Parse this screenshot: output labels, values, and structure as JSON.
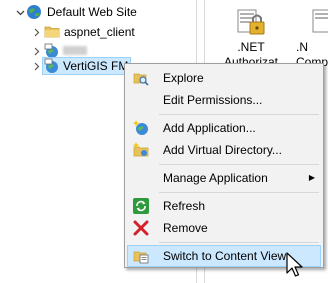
{
  "tree": {
    "items": [
      {
        "label": "Default Web Site",
        "chevron": "expanded",
        "icon": "globe-icon"
      },
      {
        "label": "aspnet_client",
        "chevron": "collapsed",
        "icon": "folder-icon"
      },
      {
        "label": "",
        "chevron": "collapsed",
        "icon": "web-app-icon"
      },
      {
        "label": "VertiGIS FM",
        "chevron": "collapsed",
        "icon": "web-app-icon",
        "selected": true
      }
    ]
  },
  "features": {
    "items": [
      {
        "label": ".NET Authorizat",
        "icon": "net-authorization-icon"
      },
      {
        "label": ".N Compi",
        "icon": "net-compilation-icon"
      }
    ]
  },
  "context_menu": {
    "items": [
      {
        "label": "Explore",
        "icon": "explore-icon"
      },
      {
        "label": "Edit Permissions...",
        "icon": ""
      },
      {
        "label": "Add Application...",
        "icon": "add-application-icon"
      },
      {
        "label": "Add Virtual Directory...",
        "icon": "add-virtual-directory-icon"
      },
      {
        "label": "Manage Application",
        "icon": "",
        "submenu": true
      },
      {
        "label": "Refresh",
        "icon": "refresh-icon"
      },
      {
        "label": "Remove",
        "icon": "remove-icon"
      },
      {
        "label": "Switch to Content View",
        "icon": "content-view-icon",
        "highlighted": true
      }
    ]
  },
  "colors": {
    "selection_bg": "#cce8ff",
    "selection_border": "#99d1ff",
    "menu_bg": "#f2f2f2"
  }
}
